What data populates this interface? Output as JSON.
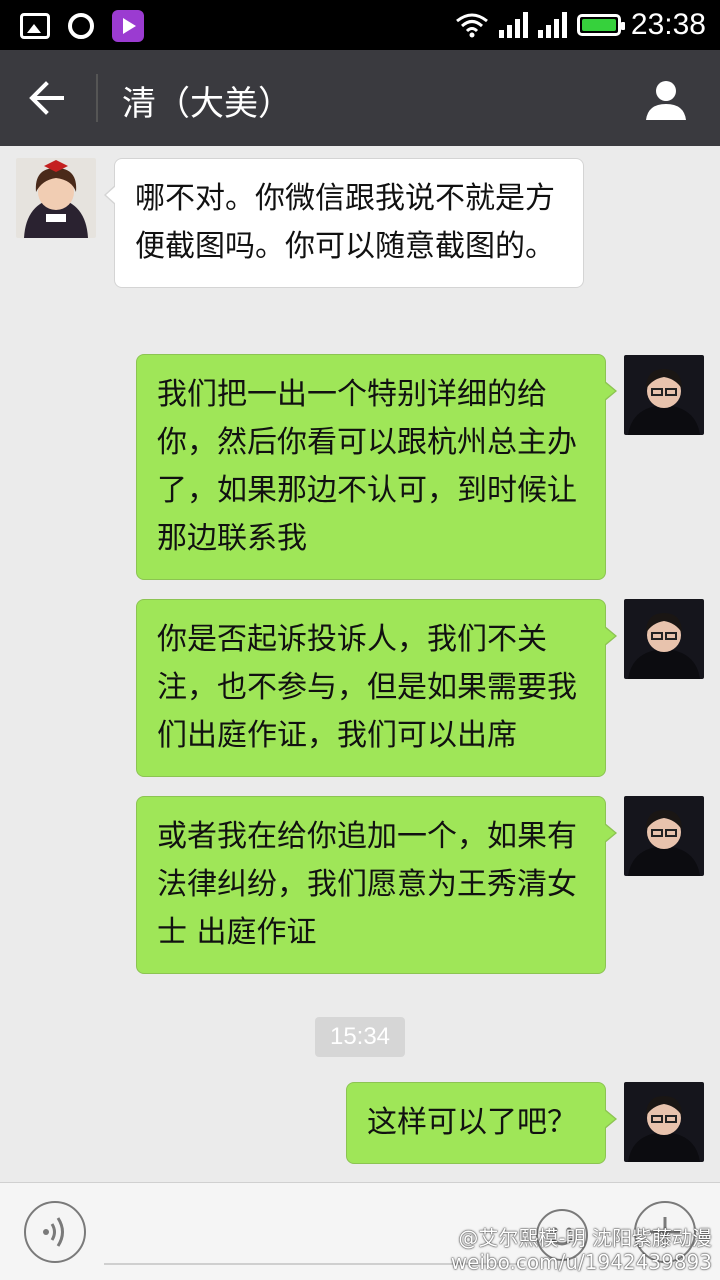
{
  "status_bar": {
    "time": "23:38",
    "left_icons": [
      "gallery-icon",
      "chat-icon",
      "video-app-icon"
    ],
    "right_icons": [
      "wifi-icon",
      "signal-icon",
      "signal-icon",
      "battery-icon"
    ]
  },
  "header": {
    "title": "清（大美）",
    "back_icon": "back-arrow-icon",
    "profile_icon": "person-icon"
  },
  "messages": [
    {
      "side": "in",
      "text": "哪不对。你微信跟我说不就是方便截图吗。你可以随意截图的。"
    },
    {
      "side": "out",
      "text": "我们把一出一个特别详细的给你，然后你看可以跟杭州总主办了，如果那边不认可，到时候让那边联系我"
    },
    {
      "side": "out",
      "text": "你是否起诉投诉人，我们不关注，也不参与，但是如果需要我们出庭作证，我们可以出席"
    },
    {
      "side": "out",
      "text": "或者我在给你追加一个，如果有法律纠纷，我们愿意为王秀清女士 出庭作证"
    },
    {
      "side": "out",
      "text": "这样可以了吧？"
    }
  ],
  "timestamp": "15:34",
  "input_bar": {
    "voice_icon": "voice-icon",
    "emoji_icon": "emoji-icon",
    "plus_icon": "plus-icon",
    "placeholder": ""
  },
  "watermark": {
    "line1": "@艾尔熙模-明 沈阳紫藤动漫",
    "line2": "weibo.com/u/1942439893"
  },
  "colors": {
    "status_bar": "#000000",
    "title_bar": "#3a3a3f",
    "chat_bg": "#ebebeb",
    "out_bubble": "#9fe658",
    "in_bubble": "#ffffff"
  }
}
